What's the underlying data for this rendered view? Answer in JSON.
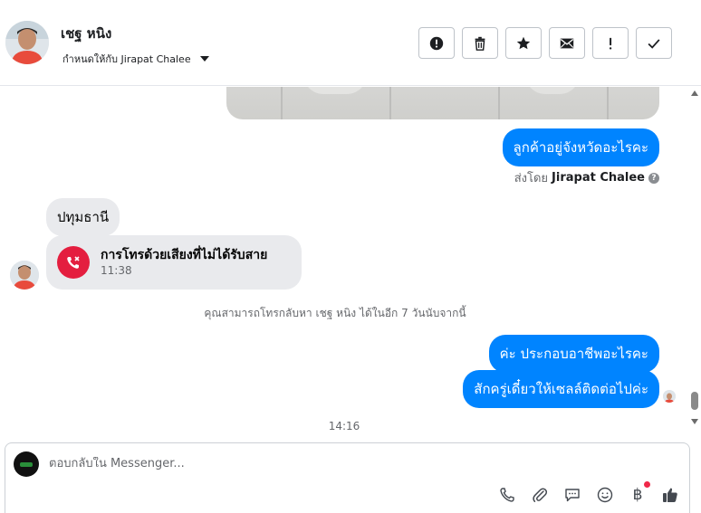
{
  "header": {
    "contact_name": "เชฐ หนิง",
    "assigned_to": "กำหนดให้กับ Jirapat Chalee",
    "actions": [
      {
        "name": "spam-button",
        "icon": "alert-circle-icon"
      },
      {
        "name": "delete-button",
        "icon": "trash-icon"
      },
      {
        "name": "star-button",
        "icon": "star-icon"
      },
      {
        "name": "mark-unread-button",
        "icon": "envelope-icon"
      },
      {
        "name": "follow-up-button",
        "icon": "exclamation-icon"
      },
      {
        "name": "done-button",
        "icon": "check-icon"
      }
    ]
  },
  "messages": {
    "out1": "ลูกค้าอยู่จังหวัดอะไรคะ",
    "sent_by_prefix": "ส่งโดย",
    "sent_by_name": "Jirapat Chalee",
    "in1": "ปทุมธานี",
    "call_title": "การโทรด้วยเสียงที่ไม่ได้รับสาย",
    "call_time": "11:38",
    "system_note": "คุณสามารถโทรกลับหา เชฐ หนิง ได้ในอีก 7 วันนับจากนี้",
    "out2": "ค่ะ ประกอบอาชีพอะไรคะ",
    "out3": "สักครู่เดี๋ยวให้เซลล์ติดต่อไปค่ะ",
    "timestamp": "14:16"
  },
  "composer": {
    "placeholder": "ตอบกลับใน Messenger..."
  },
  "colors": {
    "accent": "#0084ff",
    "missed_call": "#e41e3f",
    "incoming_bubble": "#e9eaed"
  }
}
